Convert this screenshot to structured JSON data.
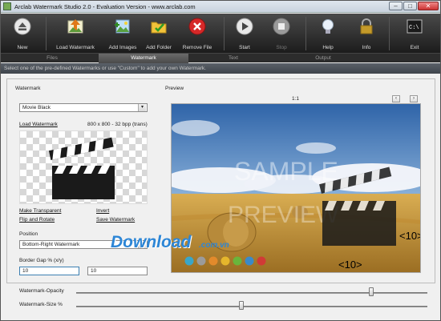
{
  "window": {
    "title": "Arclab Watermark Studio 2.0 - Evaluation Version - www.arclab.com",
    "minimize": "–",
    "maximize": "□",
    "close": "✕"
  },
  "toolbar": {
    "new": "New",
    "load_watermark": "Load Watermark",
    "add_images": "Add Images",
    "add_folder": "Add Folder",
    "remove_file": "Remove File",
    "start": "Start",
    "stop": "Stop",
    "help": "Help",
    "info": "Info",
    "exit": "Exit"
  },
  "tabs": [
    "Files",
    "Watermark",
    "Text",
    "Output"
  ],
  "active_tab": "Watermark",
  "hint": "Select one of the pre-defined Watermarks or use \"Custom\" to add your own Watermark.",
  "watermark": {
    "section_label": "Watermark",
    "preset_selected": "Movie Black",
    "load_link": "Load Watermark",
    "info": "800 x 800 - 32 bpp (trans)",
    "make_transparent": "Make Transparent",
    "invert": "Invert",
    "flip_rotate": "Flip and Rotate",
    "save_watermark": "Save Watermark"
  },
  "position": {
    "label": "Position",
    "selected": "Bottom-Right Watermark",
    "border_gap_label": "Border Gap % (x/y)",
    "gap_x": "10",
    "gap_y": "10"
  },
  "preview": {
    "label": "Preview",
    "zoom": "1:1",
    "prev": "‹",
    "next": "›",
    "sample_text": "SAMPLE",
    "sample_text2": "PREVIEW",
    "gap_x_marker": "<10>",
    "gap_y_marker": "<10>"
  },
  "sliders": {
    "opacity_label": "Watermark-Opacity",
    "opacity_value": 0.84,
    "size_label": "Watermark-Size %",
    "size_value": 0.47
  },
  "overlay": {
    "brand": "Download",
    "brand_suffix": ".com.vn"
  },
  "colors": {
    "toolbar_bg": "#2a2a2a",
    "accent_green": "#5fa830",
    "sky": "#4b7fbf",
    "field": "#c9a03e"
  }
}
